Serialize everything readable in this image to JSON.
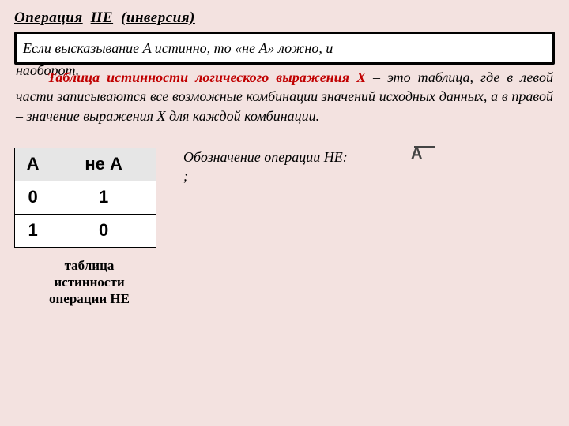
{
  "title_parts": {
    "op": "Операция",
    "not": "НЕ",
    "inv": "(инверсия)"
  },
  "rule_line1": "Если высказывание A истинно, то «не А» ложно, и",
  "rule_line2": "наоборот.",
  "definition_lead": "Таблица истинности логического выражения Х",
  "definition_rest": " – это таблица, где в левой части записываются все возможные комбинации значений исходных данных, а в правой – значение выражения Х для каждой комбинации.",
  "truth_table": {
    "head": {
      "a": "А",
      "nota": "не  А"
    },
    "rows": [
      {
        "a": "0",
        "nota": "1"
      },
      {
        "a": "1",
        "nota": "0"
      }
    ],
    "caption_l1": "таблица",
    "caption_l2": "истинности",
    "caption_l3": "операции НЕ"
  },
  "notation_line1": "Обозначение операции НЕ:",
  "notation_line2": ";",
  "notation_symbol": "А"
}
